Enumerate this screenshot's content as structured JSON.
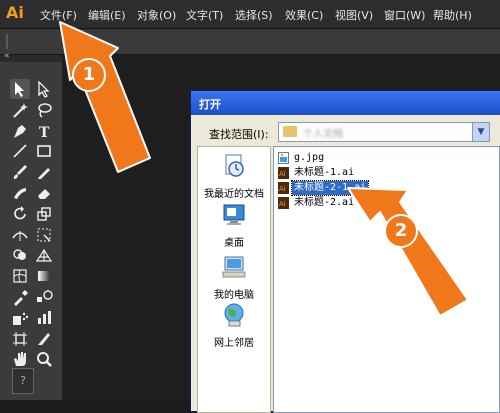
{
  "app": {
    "logo": "Ai"
  },
  "menu": [
    "文件(F)",
    "编辑(E)",
    "对象(O)",
    "文字(T)",
    "选择(S)",
    "效果(C)",
    "视图(V)",
    "窗口(W)",
    "帮助(H)"
  ],
  "tools": [
    {
      "name": "selection-tool"
    },
    {
      "name": "direct-selection-tool"
    },
    {
      "name": "magic-wand-tool"
    },
    {
      "name": "lasso-tool"
    },
    {
      "name": "pen-tool"
    },
    {
      "name": "type-tool"
    },
    {
      "name": "line-tool"
    },
    {
      "name": "rectangle-tool"
    },
    {
      "name": "paintbrush-tool"
    },
    {
      "name": "pencil-tool"
    },
    {
      "name": "blob-brush-tool"
    },
    {
      "name": "eraser-tool"
    },
    {
      "name": "rotate-tool"
    },
    {
      "name": "scale-tool"
    },
    {
      "name": "width-tool"
    },
    {
      "name": "free-transform-tool"
    },
    {
      "name": "shape-builder-tool"
    },
    {
      "name": "perspective-grid-tool"
    },
    {
      "name": "mesh-tool"
    },
    {
      "name": "gradient-tool"
    },
    {
      "name": "eyedropper-tool"
    },
    {
      "name": "blend-tool"
    },
    {
      "name": "symbol-sprayer-tool"
    },
    {
      "name": "column-graph-tool"
    },
    {
      "name": "artboard-tool"
    },
    {
      "name": "slice-tool"
    },
    {
      "name": "hand-tool"
    },
    {
      "name": "zoom-tool"
    }
  ],
  "help_glyph": "?",
  "dialog": {
    "title": "打开",
    "look_in_label": "查找范围(I):",
    "look_in_value": "个人文档",
    "places": [
      {
        "label": "我最近的文档",
        "icon": "recent-documents-icon"
      },
      {
        "label": "桌面",
        "icon": "desktop-icon"
      },
      {
        "label": "我的电脑",
        "icon": "my-computer-icon"
      },
      {
        "label": "网上邻居",
        "icon": "network-places-icon"
      }
    ],
    "files": [
      {
        "name": "g.jpg",
        "type": "jpg",
        "selected": false
      },
      {
        "name": "未标题-1.ai",
        "type": "ai",
        "selected": false
      },
      {
        "name": "未标题-2-1.ai",
        "type": "ai",
        "selected": true
      },
      {
        "name": "未标题-2.ai",
        "type": "ai",
        "selected": false
      }
    ]
  },
  "annotations": [
    {
      "label": "1"
    },
    {
      "label": "2"
    }
  ],
  "colors": {
    "annotation": "#f0781a",
    "ai_brand": "#f29d1f",
    "selection": "#316ac5"
  }
}
